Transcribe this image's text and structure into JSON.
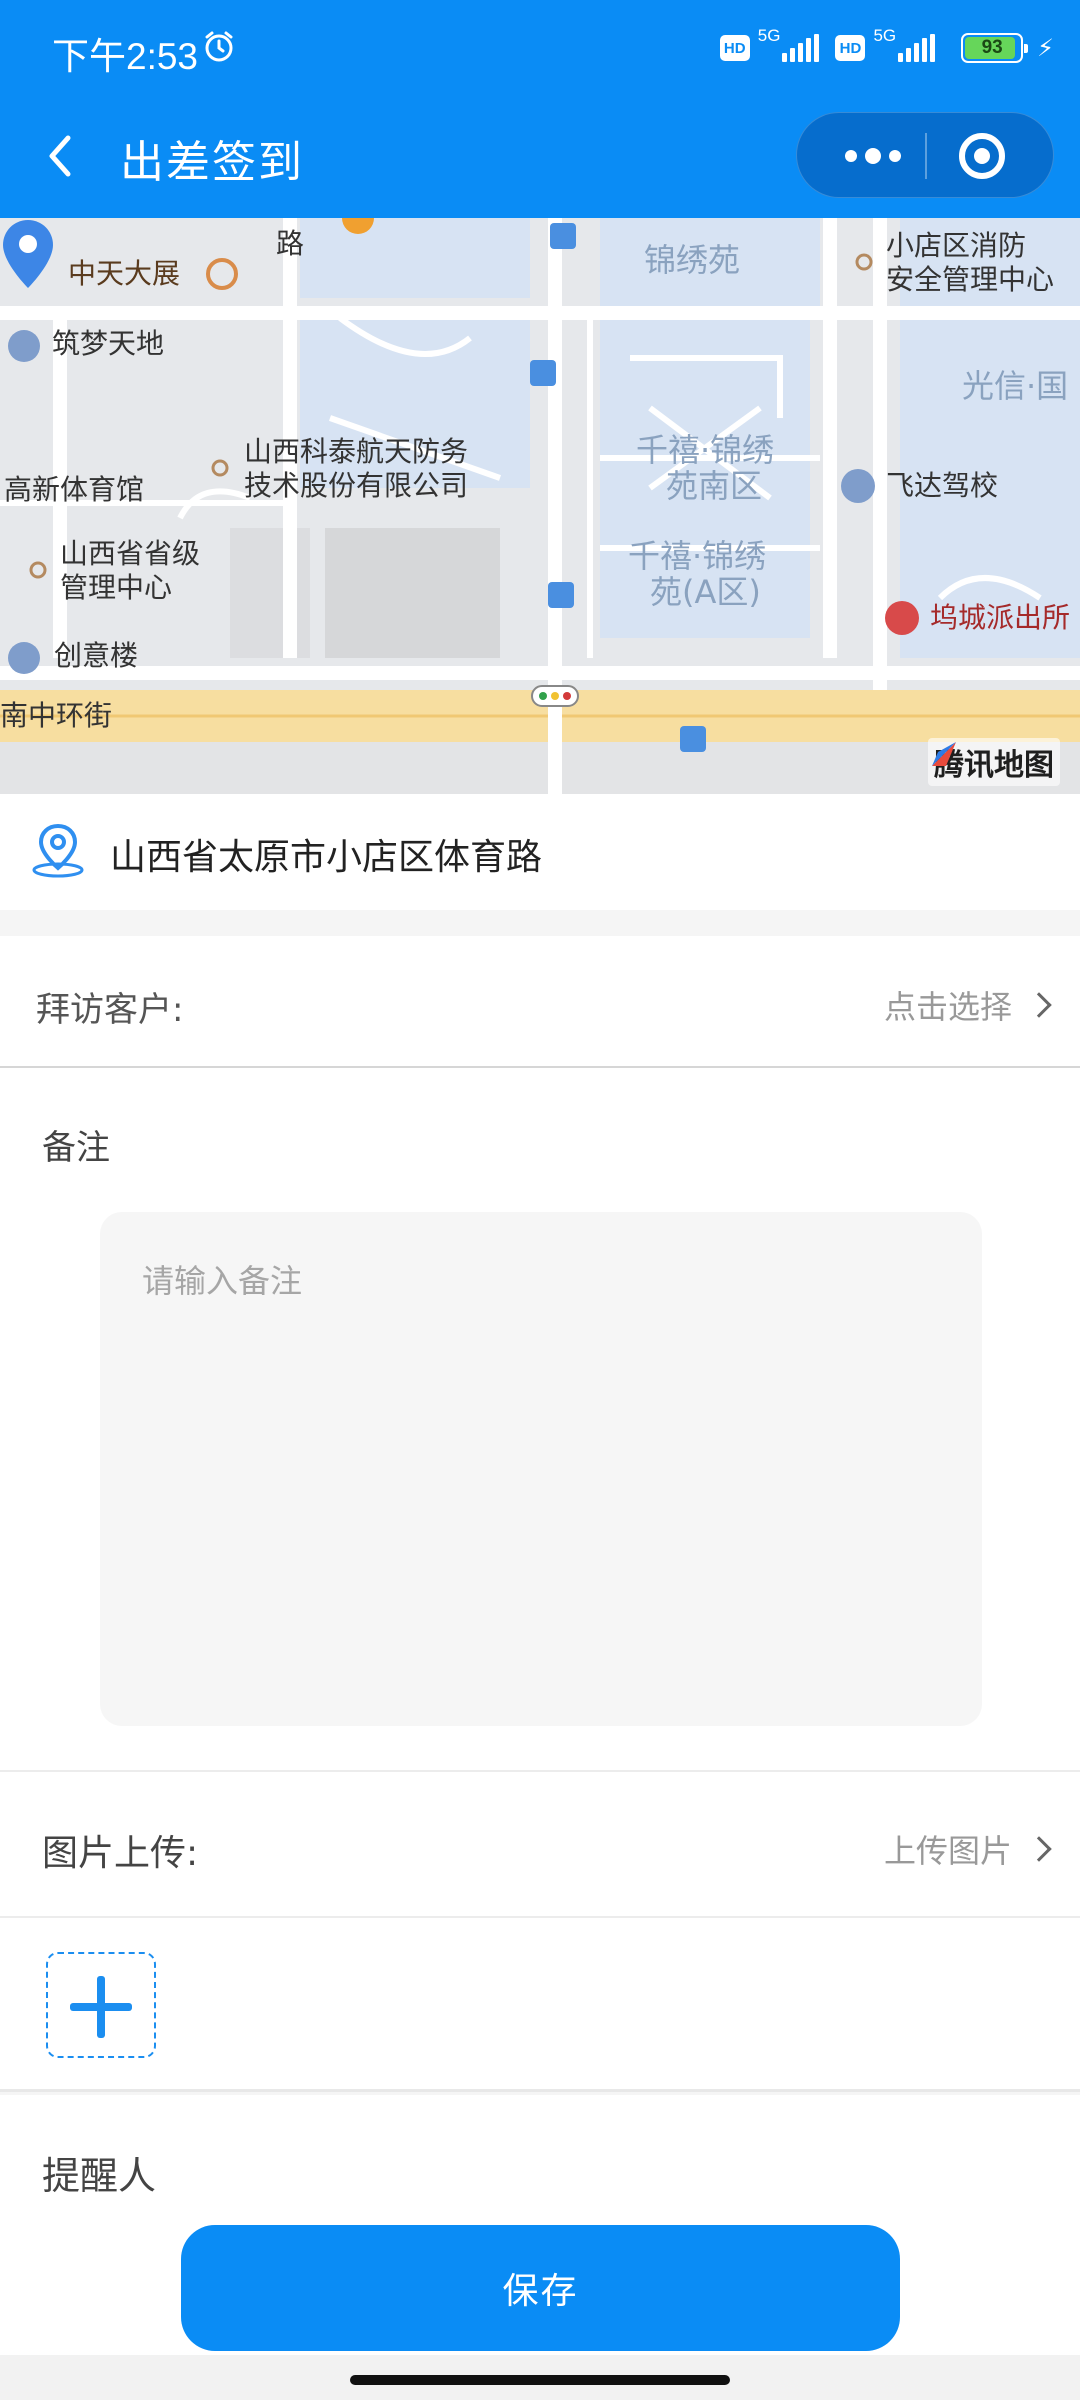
{
  "status_bar": {
    "time": "下午2:53",
    "hd_label": "HD",
    "network_label": "5G",
    "battery_level": "93",
    "battery_fraction": 0.93
  },
  "nav": {
    "title": "出差签到"
  },
  "map": {
    "labels": [
      "中天大展",
      "筑梦天地",
      "高新体育馆",
      "山西科泰航天防务",
      "技术股份有限公司",
      "山西省省级",
      "管理中心",
      "创意楼",
      "南中环街",
      "锦绣苑",
      "千禧·锦绣",
      "苑南区",
      "千禧·锦绣",
      "苑(A区)",
      "小店区消防",
      "安全管理中心",
      "光信·国",
      "飞达驾校",
      "坞城派出所",
      "路"
    ],
    "brand": "腾讯地图"
  },
  "address": "山西省太原市小店区体育路",
  "customer": {
    "label": "拜访客户:",
    "action": "点击选择"
  },
  "remark": {
    "label": "备注",
    "placeholder": "请输入备注",
    "value": ""
  },
  "upload": {
    "label": "图片上传:",
    "action": "上传图片"
  },
  "reminder": {
    "label": "提醒人"
  },
  "save_label": "保存",
  "colors": {
    "primary": "#0a8cf5",
    "battery": "#66d65a"
  }
}
